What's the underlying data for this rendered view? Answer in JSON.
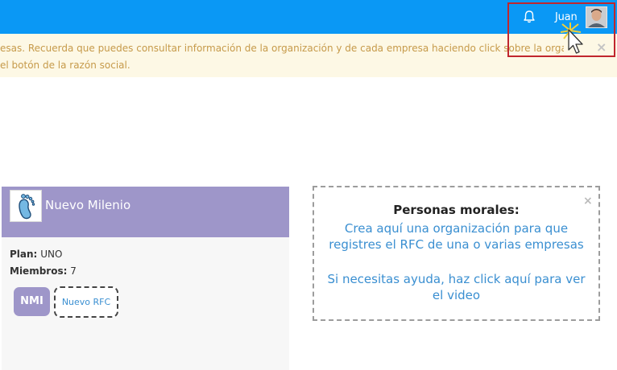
{
  "header": {
    "username": "Juan",
    "icons": {
      "bell": "bell-icon",
      "avatar": "user-avatar"
    }
  },
  "notice": {
    "line1": "esas. Recuerda que puedes consultar información de la organización y de cada empresa haciendo click sobre la organización.",
    "line2": "el botón de la razón social.",
    "close": "×"
  },
  "organization": {
    "name": "Nuevo Milenio",
    "plan_label": "Plan:",
    "plan_value": "UNO",
    "members_label": "Miembros:",
    "members_value": "7",
    "badge": "NMI",
    "new_rfc": "Nuevo RFC"
  },
  "empty_state": {
    "title": "Personas morales:",
    "line1": "Crea aquí una organización para que",
    "line2": "registres el RFC de una o varias empresas",
    "line3": "Si necesitas ayuda, haz click aquí para ver",
    "line4": "el video",
    "close": "×"
  },
  "colors": {
    "topbar": "#0a98f5",
    "notice_bg": "#fdf8e5",
    "notice_text": "#c69a4a",
    "org_header": "#9e96c9",
    "link": "#3a8fd1",
    "highlight": "#c0262d"
  }
}
